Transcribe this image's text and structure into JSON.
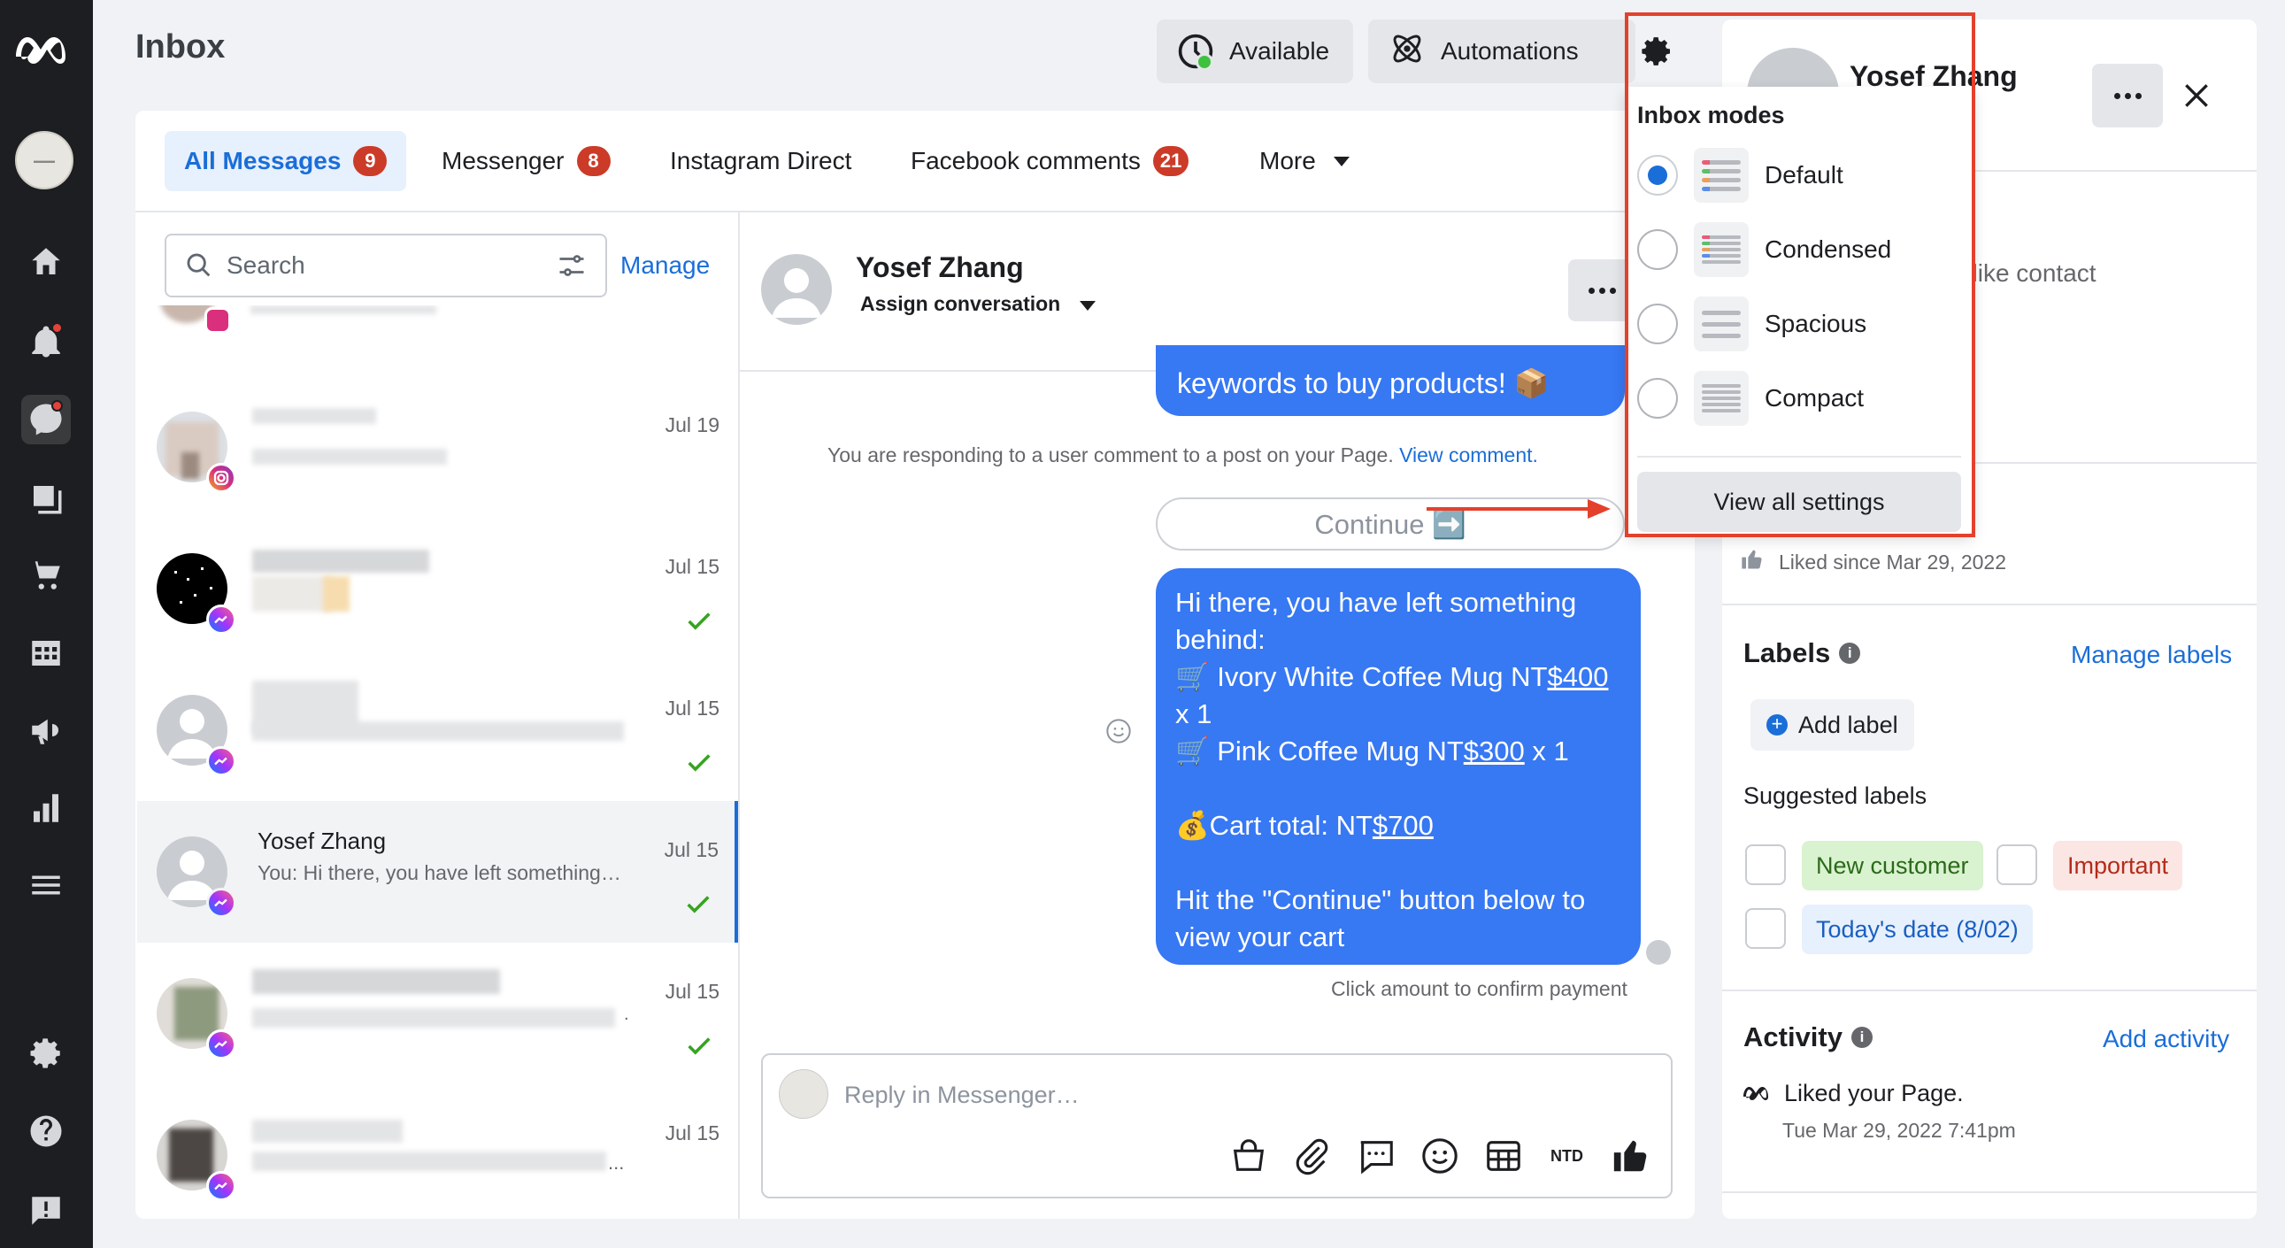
{
  "header": {
    "title": "Inbox",
    "available_label": "Available",
    "automations_label": "Automations"
  },
  "tabs": [
    {
      "label": "All Messages",
      "count": "9"
    },
    {
      "label": "Messenger",
      "count": "8"
    },
    {
      "label": "Instagram Direct"
    },
    {
      "label": "Facebook comments",
      "count": "21"
    },
    {
      "label": "More"
    }
  ],
  "search": {
    "placeholder": "Search",
    "manage_label": "Manage"
  },
  "conversations": [
    {
      "date": "Jul 19",
      "platform": "instagram"
    },
    {
      "date": "Jul 15",
      "platform": "messenger"
    },
    {
      "date": "Jul 15",
      "platform": "messenger"
    },
    {
      "name": "Yosef Zhang",
      "preview": "You: Hi there, you have left something…",
      "date": "Jul 15",
      "platform": "messenger"
    },
    {
      "date": "Jul 15",
      "platform": "messenger",
      "preview": "."
    },
    {
      "date": "Jul 15",
      "platform": "messenger",
      "preview": "..."
    }
  ],
  "chat": {
    "name": "Yosef Zhang",
    "assign_label": "Assign conversation",
    "top_bubble": "keywords to buy products! 📦",
    "notice": "You are responding to a user comment to a post on your Page.",
    "notice_link": "View comment.",
    "continue_label": "Continue ➡️",
    "msg": {
      "l1": "Hi there, you have left something",
      "l2": "behind:",
      "item1_pre": "🛒 Ivory White Coffee Mug NT",
      "item1_amt": "$400",
      "item1_qty": "x 1",
      "item2_pre": "🛒 Pink Coffee Mug NT",
      "item2_amt": "$300",
      "item2_qty": " x 1",
      "total_pre": "💰Cart total:  NT",
      "total_amt": "$700",
      "l_hit1": "Hit the \"Continue\" button below to",
      "l_hit2": "view your cart"
    },
    "footnote": "Click amount to confirm payment",
    "reply_placeholder": "Reply in Messenger…",
    "currency_label": "NTD"
  },
  "profile": {
    "name": "Yosef Zhang",
    "partial_text": "ople, like contact",
    "liked_since": "Liked since Mar 29, 2022",
    "labels_title": "Labels",
    "manage_labels": "Manage labels",
    "add_label": "Add label",
    "suggested_title": "Suggested labels",
    "suggested": [
      {
        "label": "New customer",
        "color": "#d9f2cf",
        "text_color": "#2b6a1b"
      },
      {
        "label": "Important",
        "color": "#fbe6e3",
        "text_color": "#b42b1a"
      },
      {
        "label": "Today's date (8/02)",
        "color": "#e7f0fd",
        "text_color": "#1a5fc0"
      }
    ],
    "activity_title": "Activity",
    "add_activity": "Add activity",
    "activity_item": "Liked your Page.",
    "activity_time": "Tue Mar 29, 2022 7:41pm"
  },
  "inbox_modes": {
    "title": "Inbox modes",
    "options": [
      {
        "label": "Default",
        "selected": true
      },
      {
        "label": "Condensed",
        "selected": false
      },
      {
        "label": "Spacious",
        "selected": false
      },
      {
        "label": "Compact",
        "selected": false
      }
    ],
    "view_all_label": "View all settings"
  },
  "colors": {
    "accent": "#1a6ed8",
    "bubble": "#3778f3",
    "highlight": "#e4412c",
    "badge": "#cc3b28",
    "nav": "#1c1e21"
  }
}
